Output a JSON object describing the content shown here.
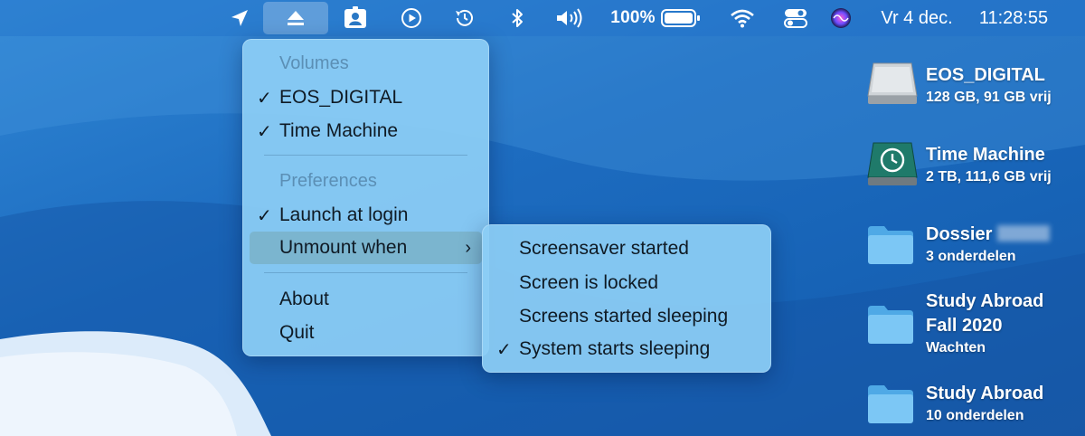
{
  "menubar": {
    "icons": [
      "location-arrow-icon",
      "eject-icon",
      "contacts-icon",
      "play-circle-icon",
      "time-machine-icon",
      "bluetooth-icon",
      "volume-icon",
      "battery-icon",
      "wifi-icon",
      "control-center-icon",
      "siri-icon"
    ],
    "battery_percent": "100%",
    "date": "Vr 4 dec.",
    "time": "11:28:55"
  },
  "menu": {
    "volumes_header": "Volumes",
    "volumes": [
      {
        "label": "EOS_DIGITAL",
        "checked": true
      },
      {
        "label": "Time Machine",
        "checked": true
      }
    ],
    "preferences_header": "Preferences",
    "launch_at_login": "Launch at login",
    "unmount_when": "Unmount when",
    "about": "About",
    "quit": "Quit",
    "check_mark": "✓",
    "chevron": "›"
  },
  "submenu": {
    "items": [
      {
        "label": "Screensaver started",
        "checked": false
      },
      {
        "label": "Screen is locked",
        "checked": false
      },
      {
        "label": "Screens started sleeping",
        "checked": false
      },
      {
        "label": "System starts sleeping",
        "checked": true
      }
    ]
  },
  "desktop": [
    {
      "title": "EOS_DIGITAL",
      "subtitle": "128 GB, 91 GB vrij",
      "icon": "external-drive-icon"
    },
    {
      "title": "Time Machine",
      "subtitle": "2 TB, 111,6 GB vrij",
      "icon": "time-machine-drive-icon"
    },
    {
      "title": "Dossier",
      "subtitle": "3 onderdelen",
      "icon": "folder-icon"
    },
    {
      "title": "Study Abroad",
      "title2": "Fall 2020",
      "subtitle": "Wachten",
      "icon": "folder-icon"
    },
    {
      "title": "Study Abroad",
      "subtitle": "10 onderdelen",
      "icon": "folder-icon"
    }
  ],
  "colors": {
    "menu_bg": "#8ccdf5",
    "highlight": "#78afc3",
    "wallpaper": "#1f6fbf"
  }
}
